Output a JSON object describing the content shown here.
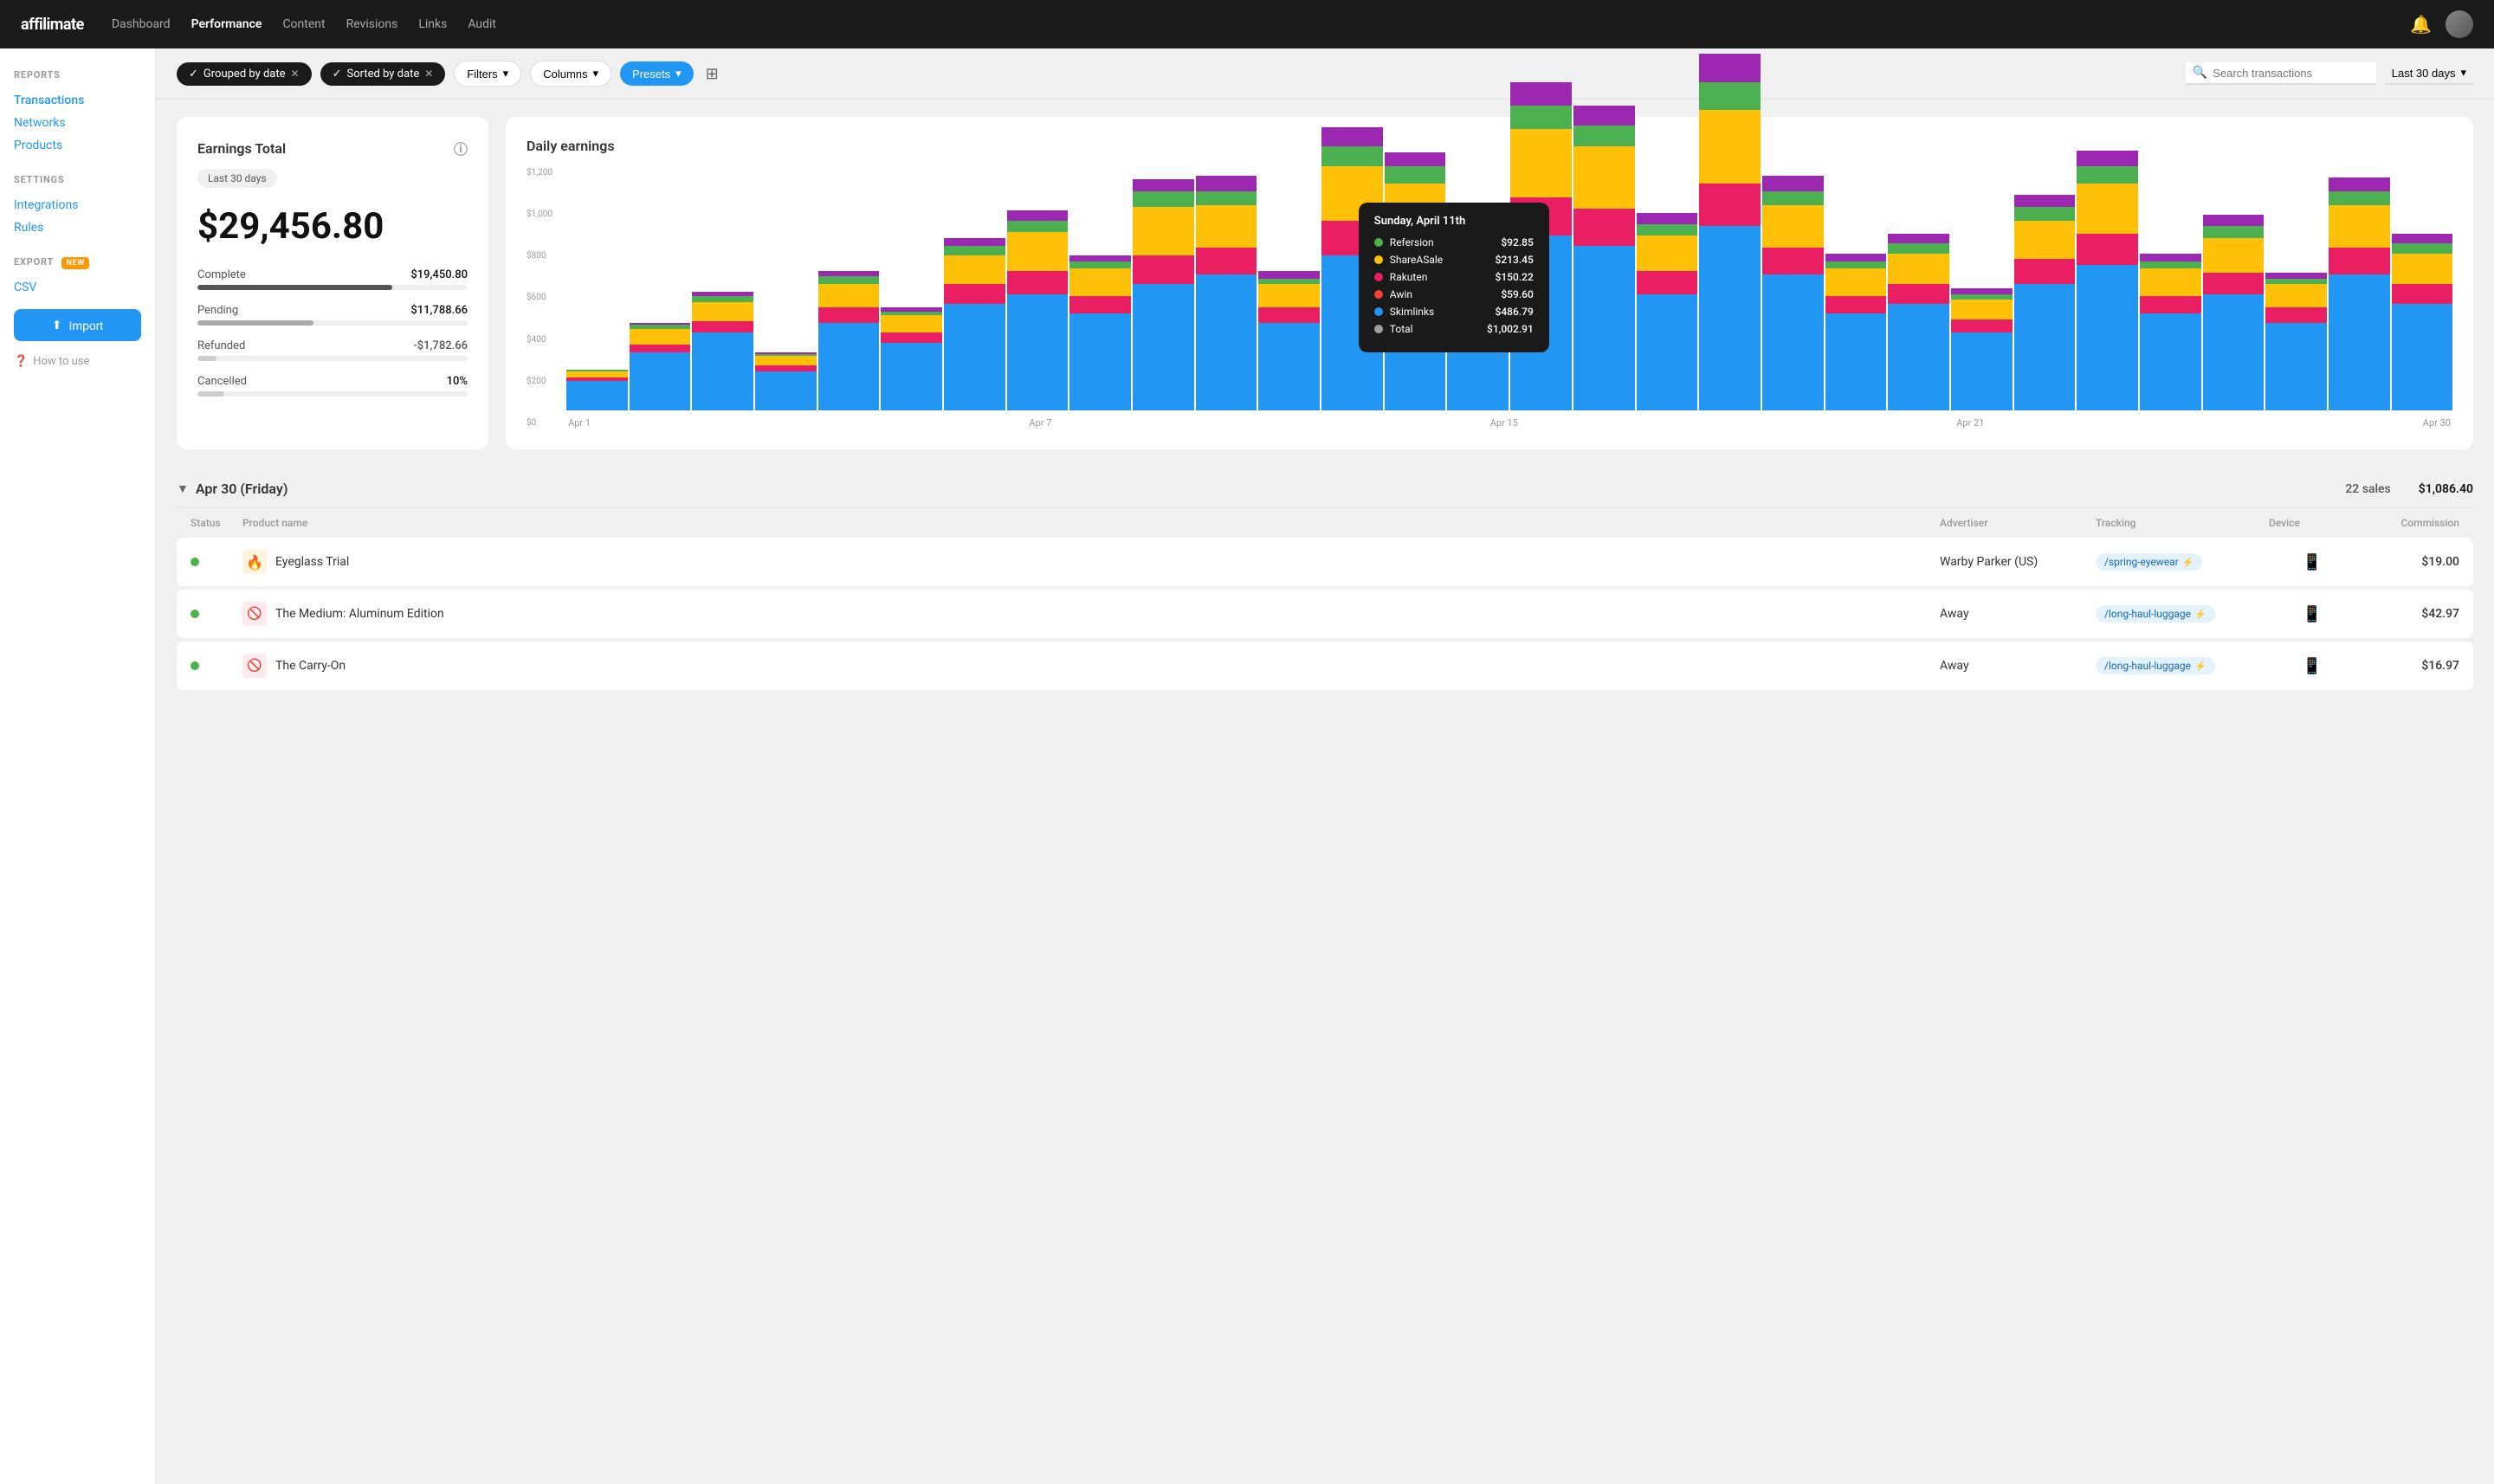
{
  "brand": {
    "name": "affilimate",
    "logo_text": "affilimate"
  },
  "nav": {
    "links": [
      {
        "label": "Dashboard",
        "active": false
      },
      {
        "label": "Performance",
        "active": true
      },
      {
        "label": "Content",
        "active": false
      },
      {
        "label": "Revisions",
        "active": false
      },
      {
        "label": "Links",
        "active": false
      },
      {
        "label": "Audit",
        "active": false
      }
    ]
  },
  "sidebar": {
    "reports_title": "REPORTS",
    "reports_links": [
      {
        "label": "Transactions",
        "active": true
      },
      {
        "label": "Networks",
        "active": false
      },
      {
        "label": "Products",
        "active": false
      }
    ],
    "settings_title": "SETTINGS",
    "settings_links": [
      {
        "label": "Integrations",
        "active": false
      },
      {
        "label": "Rules",
        "active": false
      }
    ],
    "export_title": "EXPORT",
    "export_badge": "NEW",
    "export_links": [
      {
        "label": "CSV",
        "active": false
      }
    ],
    "import_label": "Import",
    "how_to_label": "How to use"
  },
  "toolbar": {
    "chip1": "Grouped by date",
    "chip2": "Sorted by date",
    "filters_label": "Filters",
    "columns_label": "Columns",
    "presets_label": "Presets",
    "search_placeholder": "Search transactions",
    "date_range": "Last 30 days"
  },
  "earnings_card": {
    "title": "Earnings Total",
    "period": "Last 30 days",
    "total": "$29,456.80",
    "stats": [
      {
        "label": "Complete",
        "value": "$19,450.80",
        "fill_pct": 72,
        "type": "complete"
      },
      {
        "label": "Pending",
        "value": "$11,788.66",
        "fill_pct": 43,
        "type": "pending"
      },
      {
        "label": "Refunded",
        "value": "-$1,782.66",
        "fill_pct": 7,
        "type": "refunded"
      },
      {
        "label": "Cancelled",
        "value": "10%",
        "fill_pct": 10,
        "type": "cancelled"
      }
    ]
  },
  "chart": {
    "title": "Daily earnings",
    "y_labels": [
      "$1,200",
      "$1,000",
      "$800",
      "$600",
      "$400",
      "$200",
      "$0"
    ],
    "x_labels": [
      "Apr 1",
      "",
      "",
      "",
      "",
      "",
      "Apr 7",
      "",
      "",
      "",
      "",
      "",
      "",
      "Apr 15",
      "",
      "",
      "",
      "",
      "",
      "",
      "Apr 21",
      "",
      "",
      "",
      "",
      "",
      "",
      "",
      "",
      "",
      "Apr 30"
    ],
    "x_labels_sparse": [
      "Apr 1",
      "Apr 7",
      "Apr 15",
      "Apr 21",
      "Apr 30"
    ],
    "tooltip": {
      "title": "Sunday, April 11th",
      "rows": [
        {
          "label": "Refersion",
          "value": "$92.85",
          "color": "#4CAF50"
        },
        {
          "label": "ShareASale",
          "value": "$213.45",
          "color": "#FFC107"
        },
        {
          "label": "Rakuten",
          "value": "$150.22",
          "color": "#E91E63"
        },
        {
          "label": "Awin",
          "value": "$59.60",
          "color": "#F44336"
        },
        {
          "label": "Skimlinks",
          "value": "$486.79",
          "color": "#2196F3"
        },
        {
          "label": "Total",
          "value": "$1,002.91",
          "color": "#9E9E9E"
        }
      ]
    },
    "bars": [
      {
        "blue": 15,
        "red": 2,
        "yellow": 3,
        "green": 1,
        "purple": 0
      },
      {
        "blue": 30,
        "red": 4,
        "yellow": 8,
        "green": 2,
        "purple": 1
      },
      {
        "blue": 40,
        "red": 6,
        "yellow": 10,
        "green": 3,
        "purple": 2
      },
      {
        "blue": 20,
        "red": 3,
        "yellow": 5,
        "green": 1,
        "purple": 1
      },
      {
        "blue": 45,
        "red": 8,
        "yellow": 12,
        "green": 4,
        "purple": 3
      },
      {
        "blue": 35,
        "red": 5,
        "yellow": 9,
        "green": 2,
        "purple": 2
      },
      {
        "blue": 55,
        "red": 10,
        "yellow": 15,
        "green": 5,
        "purple": 4
      },
      {
        "blue": 60,
        "red": 12,
        "yellow": 20,
        "green": 6,
        "purple": 5
      },
      {
        "blue": 50,
        "red": 9,
        "yellow": 14,
        "green": 4,
        "purple": 3
      },
      {
        "blue": 65,
        "red": 15,
        "yellow": 25,
        "green": 8,
        "purple": 6
      },
      {
        "blue": 70,
        "red": 14,
        "yellow": 22,
        "green": 7,
        "purple": 8
      },
      {
        "blue": 45,
        "red": 8,
        "yellow": 12,
        "green": 3,
        "purple": 4
      },
      {
        "blue": 80,
        "red": 18,
        "yellow": 28,
        "green": 10,
        "purple": 10
      },
      {
        "blue": 75,
        "red": 16,
        "yellow": 26,
        "green": 9,
        "purple": 7
      },
      {
        "blue": 55,
        "red": 10,
        "yellow": 16,
        "green": 5,
        "purple": 5
      },
      {
        "blue": 90,
        "red": 20,
        "yellow": 35,
        "green": 12,
        "purple": 12
      },
      {
        "blue": 85,
        "red": 19,
        "yellow": 32,
        "green": 11,
        "purple": 10
      },
      {
        "blue": 60,
        "red": 12,
        "yellow": 18,
        "green": 6,
        "purple": 6
      },
      {
        "blue": 95,
        "red": 22,
        "yellow": 38,
        "green": 14,
        "purple": 15
      },
      {
        "blue": 70,
        "red": 14,
        "yellow": 22,
        "green": 7,
        "purple": 8
      },
      {
        "blue": 50,
        "red": 9,
        "yellow": 14,
        "green": 4,
        "purple": 4
      },
      {
        "blue": 55,
        "red": 10,
        "yellow": 16,
        "green": 5,
        "purple": 5
      },
      {
        "blue": 40,
        "red": 7,
        "yellow": 10,
        "green": 3,
        "purple": 3
      },
      {
        "blue": 65,
        "red": 13,
        "yellow": 20,
        "green": 7,
        "purple": 6
      },
      {
        "blue": 75,
        "red": 16,
        "yellow": 26,
        "green": 9,
        "purple": 8
      },
      {
        "blue": 50,
        "red": 9,
        "yellow": 14,
        "green": 4,
        "purple": 4
      },
      {
        "blue": 60,
        "red": 11,
        "yellow": 18,
        "green": 6,
        "purple": 6
      },
      {
        "blue": 45,
        "red": 8,
        "yellow": 12,
        "green": 3,
        "purple": 3
      },
      {
        "blue": 70,
        "red": 14,
        "yellow": 22,
        "green": 7,
        "purple": 7
      },
      {
        "blue": 55,
        "red": 10,
        "yellow": 16,
        "green": 5,
        "purple": 5
      }
    ]
  },
  "date_group": {
    "date": "Apr 30 (Friday)",
    "sales": "22 sales",
    "amount": "$1,086.40"
  },
  "table": {
    "headers": [
      "Status",
      "Product name",
      "Advertiser",
      "Tracking",
      "Device",
      "Commission"
    ],
    "rows": [
      {
        "status": "complete",
        "product_icon": "🔥",
        "product_icon_bg": "#fff3e0",
        "product_name": "Eyeglass Trial",
        "advertiser": "Warby Parker (US)",
        "tracking": "/spring-eyewear",
        "device": "mobile",
        "commission": "$19.00"
      },
      {
        "status": "complete",
        "product_icon": "🚫",
        "product_icon_bg": "#ffebee",
        "product_name": "The Medium: Aluminum Edition",
        "advertiser": "Away",
        "tracking": "/long-haul-luggage",
        "device": "mobile",
        "commission": "$42.97"
      },
      {
        "status": "complete",
        "product_icon": "🚫",
        "product_icon_bg": "#ffebee",
        "product_name": "The Carry-On",
        "advertiser": "Away",
        "tracking": "/long-haul-luggage",
        "device": "mobile",
        "commission": "$16.97"
      }
    ]
  }
}
